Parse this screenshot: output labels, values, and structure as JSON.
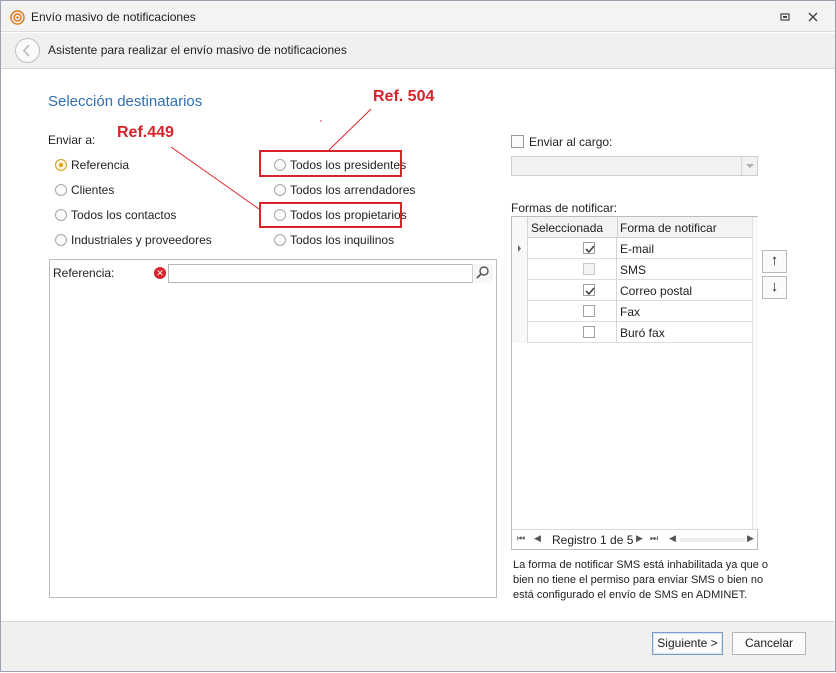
{
  "window": {
    "title": "Envío masivo de notificaciones"
  },
  "wizard": {
    "header": "Asistente para realizar el envío masivo de notificaciones"
  },
  "section": {
    "title": "Selección destinatarios"
  },
  "send_to": {
    "label": "Enviar a:",
    "options": [
      {
        "label": "Referencia",
        "selected": true
      },
      {
        "label": "Clientes",
        "selected": false
      },
      {
        "label": "Todos los contactos",
        "selected": false
      },
      {
        "label": "Industriales y proveedores",
        "selected": false
      },
      {
        "label": "Todos los presidentes",
        "selected": false
      },
      {
        "label": "Todos los arrendadores",
        "selected": false
      },
      {
        "label": "Todos los propietarios",
        "selected": false
      },
      {
        "label": "Todos los inquilinos",
        "selected": false
      }
    ]
  },
  "annotations": {
    "ref1": "Ref.449",
    "ref2": "Ref. 504",
    "color": "#d8232a"
  },
  "reference_panel": {
    "label": "Referencia:",
    "value": ""
  },
  "send_to_position": {
    "label": "Enviar al cargo:",
    "checked": false,
    "value": ""
  },
  "notify_methods": {
    "label": "Formas de notificar:",
    "columns": [
      "Seleccionada",
      "Forma de notificar"
    ],
    "rows": [
      {
        "name": "E-mail",
        "checked": true
      },
      {
        "name": "SMS",
        "checked": false
      },
      {
        "name": "Correo postal",
        "checked": true
      },
      {
        "name": "Fax",
        "checked": false
      },
      {
        "name": "Buró fax",
        "checked": false
      }
    ],
    "pager": "Registro 1 de 5"
  },
  "note": "La forma de notificar SMS está inhabilitada ya que o bien no tiene el permiso para enviar SMS o bien no está configurado el envío de SMS en ADMINET.",
  "buttons": {
    "next": "Siguiente >",
    "cancel": "Cancelar"
  },
  "colors": {
    "accent": "#2e6fb3",
    "radio_selected": "#e1a000"
  }
}
